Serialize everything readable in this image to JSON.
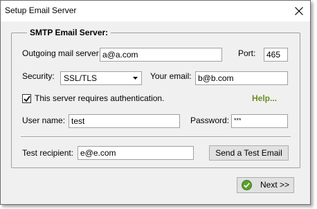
{
  "window": {
    "title": "Setup Email Server"
  },
  "group": {
    "legend": "SMTP Email Server:"
  },
  "fields": {
    "outgoing_label": "Outgoing mail server:",
    "outgoing_value": "a@a.com",
    "port_label": "Port:",
    "port_value": "465",
    "security_label": "Security:",
    "security_value": "SSL/TLS",
    "your_email_label": "Your email:",
    "your_email_value": "b@b.com",
    "auth_label": "This server requires authentication.",
    "auth_checked": true,
    "help_label": "Help...",
    "username_label": "User name:",
    "username_value": "test",
    "password_label": "Password:",
    "password_value": "***",
    "test_recipient_label": "Test recipient:",
    "test_recipient_value": "e@e.com"
  },
  "buttons": {
    "send_test": "Send a Test Email",
    "next": "Next >>"
  },
  "colors": {
    "help_link": "#6b8e23",
    "next_icon": "#5aa02c"
  },
  "icons": {
    "close": "close-icon",
    "dropdown": "chevron-down-icon",
    "check": "checkmark-icon",
    "next": "check-circle-icon"
  }
}
